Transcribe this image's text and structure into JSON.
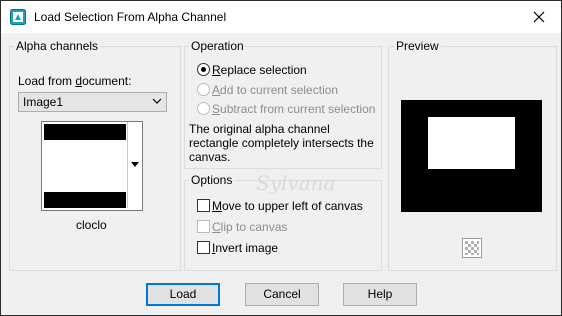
{
  "window": {
    "title": "Load Selection From Alpha Channel"
  },
  "alpha_channels": {
    "group_title": "Alpha channels",
    "load_from_label_pre": "Load from ",
    "load_from_label_ul": "d",
    "load_from_label_post": "ocument:",
    "document_select": "Image1",
    "channel_name": "cloclo"
  },
  "operation": {
    "group_title": "Operation",
    "options": [
      {
        "ul": "R",
        "rest": "eplace selection",
        "selected": true,
        "enabled": true
      },
      {
        "ul": "A",
        "rest": "dd to current selection",
        "selected": false,
        "enabled": false
      },
      {
        "ul": "S",
        "rest": "ubtract from current selection",
        "selected": false,
        "enabled": false
      }
    ],
    "info_line1": "The original alpha channel",
    "info_line2": "rectangle completely intersects the",
    "info_line3": "canvas."
  },
  "options": {
    "group_title": "Options",
    "checks": [
      {
        "ul": "M",
        "rest": "ove to upper left of canvas",
        "checked": false,
        "enabled": true
      },
      {
        "ul": "C",
        "rest": "lip to canvas",
        "checked": false,
        "enabled": false
      },
      {
        "ul": "I",
        "rest": "nvert image",
        "checked": false,
        "enabled": true
      }
    ]
  },
  "preview": {
    "group_title": "Preview"
  },
  "buttons": {
    "load": "Load",
    "cancel": "Cancel",
    "help": "Help"
  },
  "watermark": "Sylvana",
  "colors": {
    "accent": "#0078d7",
    "title_icon": "#1aa1c7"
  }
}
